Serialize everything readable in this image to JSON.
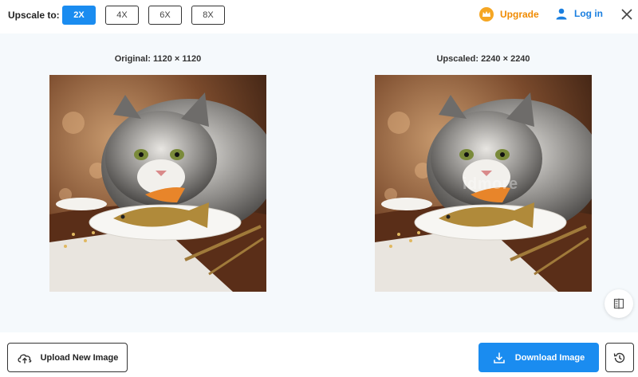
{
  "toolbar": {
    "scale_label": "Upscale to:",
    "scale_options": [
      {
        "label": "2X",
        "active": true
      },
      {
        "label": "4X",
        "active": false
      },
      {
        "label": "6X",
        "active": false
      },
      {
        "label": "8X",
        "active": false
      }
    ],
    "upgrade_label": "Upgrade",
    "login_label": "Log in"
  },
  "preview": {
    "original_caption": "Original: 1120 × 1120",
    "upscaled_caption": "Upscaled: 2240 × 2240",
    "watermark": "idmore"
  },
  "actions": {
    "upload_label": "Upload New Image",
    "download_label": "Download Image"
  },
  "colors": {
    "accent": "#1a8cf0",
    "upgrade": "#f08a00",
    "login": "#1a7fe0"
  },
  "icons": {
    "upgrade": "crown-icon",
    "login": "user-icon",
    "close": "close-icon",
    "compare": "compare-icon",
    "upload": "cloud-upload-icon",
    "download": "download-icon",
    "history": "history-icon"
  }
}
